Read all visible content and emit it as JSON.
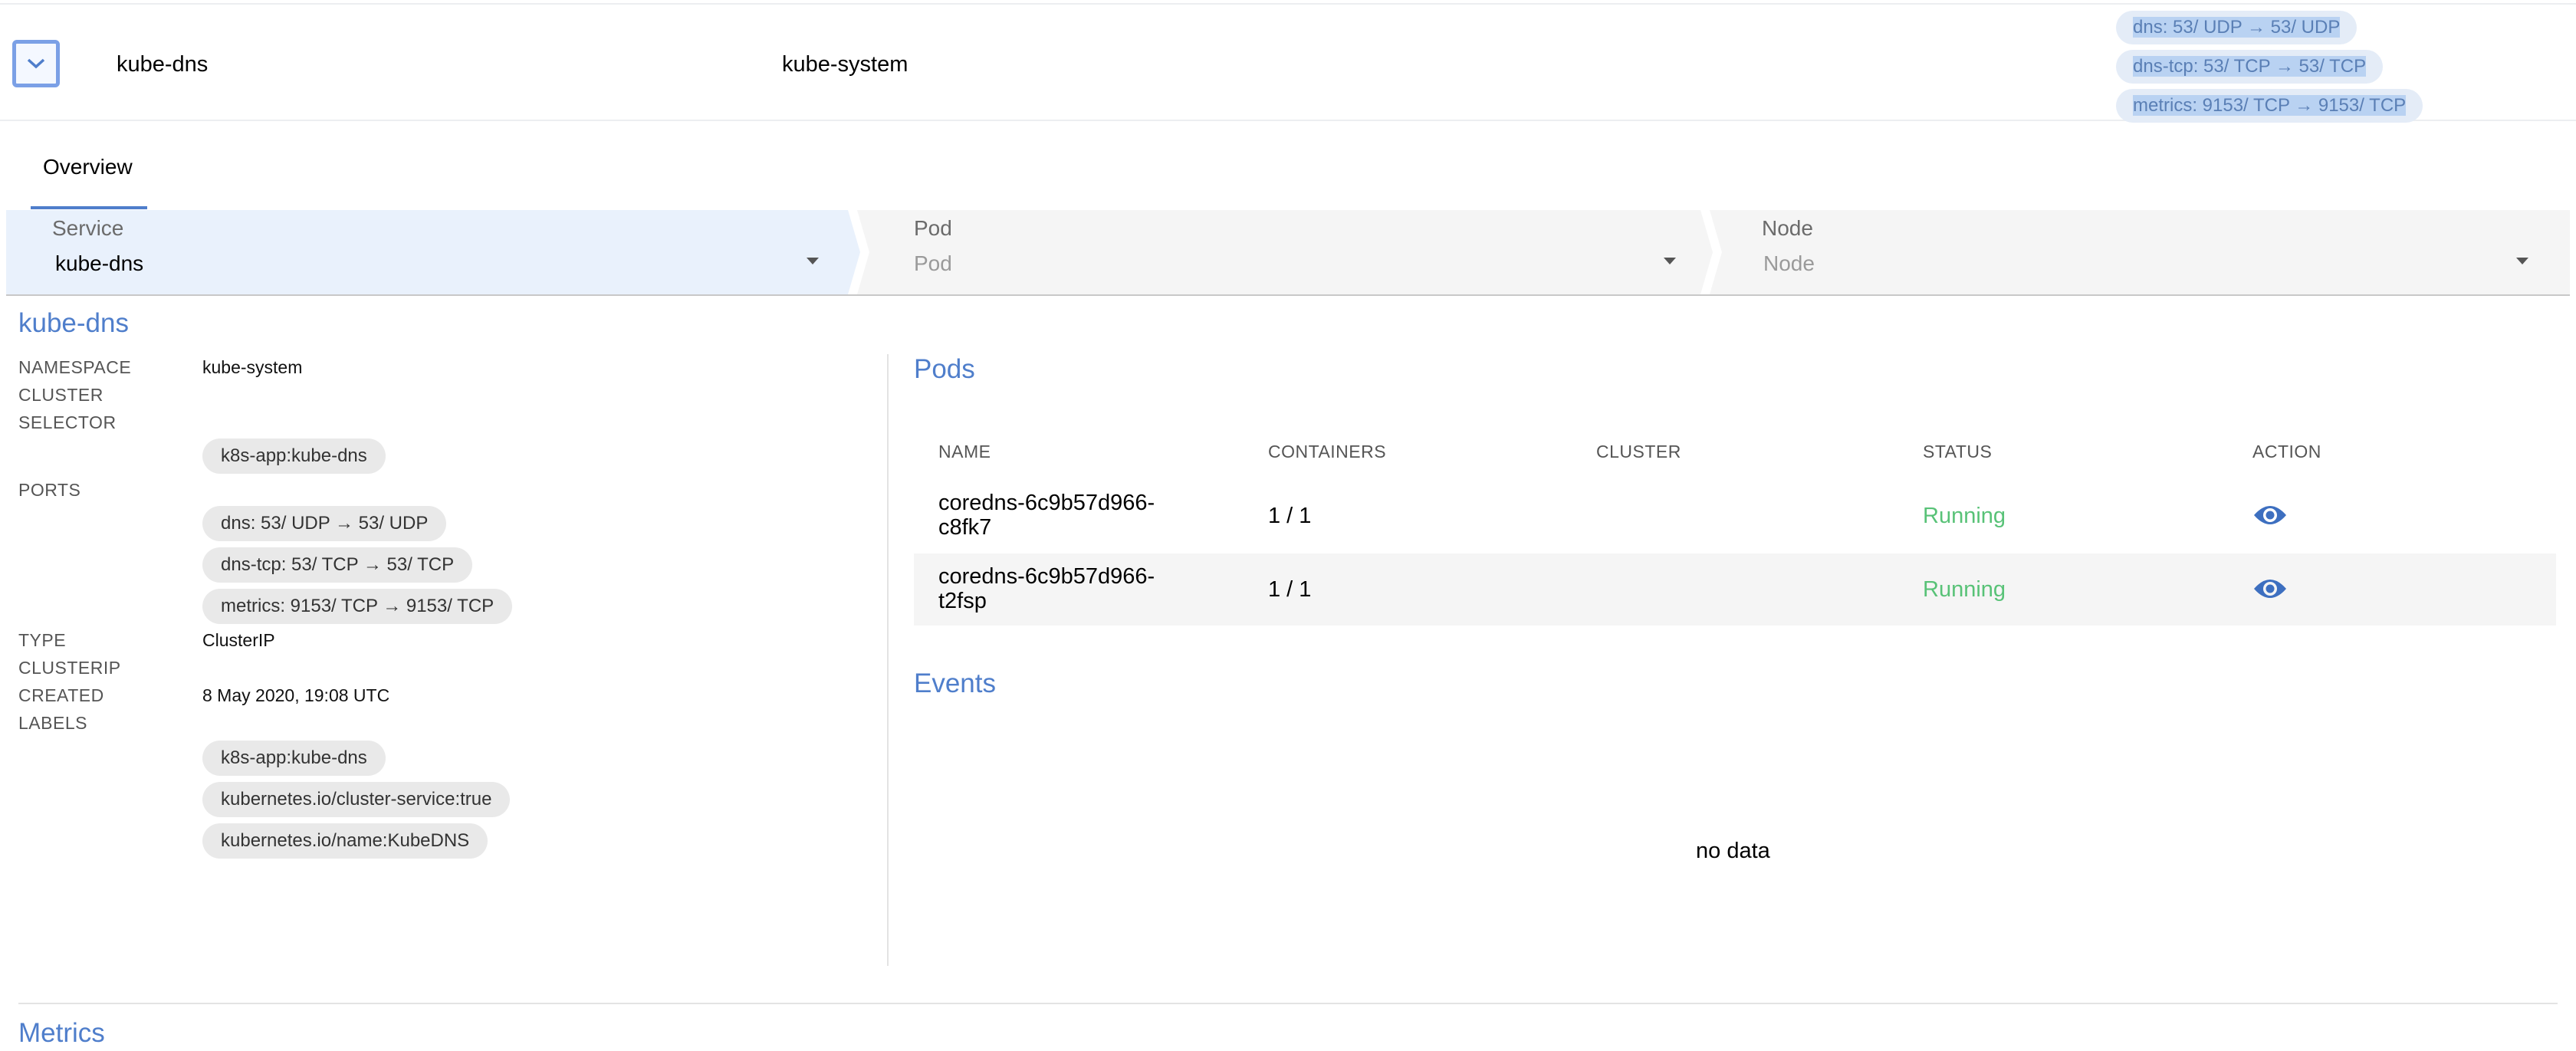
{
  "service_row": {
    "name": "kube-dns",
    "namespace": "kube-system",
    "ports": [
      "dns: 53/ UDP → 53/ UDP",
      "dns-tcp: 53/ TCP → 53/ TCP",
      "metrics: 9153/ TCP → 9153/ TCP"
    ]
  },
  "tabs": [
    {
      "label": "Overview"
    }
  ],
  "selectors": [
    {
      "label": "Service",
      "value": "kube-dns"
    },
    {
      "label": "Pod",
      "value": "Pod"
    },
    {
      "label": "Node",
      "value": "Node"
    }
  ],
  "details": {
    "title": "kube-dns",
    "namespace_label": "NAMESPACE",
    "namespace_value": "kube-system",
    "cluster_label": "CLUSTER",
    "selector_label": "SELECTOR",
    "selector_chips": [
      "k8s-app:kube-dns"
    ],
    "ports_label": "PORTS",
    "port_chips": [
      "dns: 53/ UDP → 53/ UDP",
      "dns-tcp: 53/ TCP → 53/ TCP",
      "metrics: 9153/ TCP → 9153/ TCP"
    ],
    "type_label": "TYPE",
    "type_value": "ClusterIP",
    "clusterip_label": "CLUSTERIP",
    "created_label": "CREATED",
    "created_value": "8 May 2020, 19:08 UTC",
    "labels_label": "LABELS",
    "label_chips": [
      "k8s-app:kube-dns",
      "kubernetes.io/cluster-service:true",
      "kubernetes.io/name:KubeDNS"
    ]
  },
  "pods": {
    "title": "Pods",
    "columns": [
      "NAME",
      "CONTAINERS",
      "CLUSTER",
      "STATUS",
      "ACTION"
    ],
    "rows": [
      {
        "name": "coredns-6c9b57d966-c8fk7",
        "containers": "1 / 1",
        "cluster": "",
        "status": "Running"
      },
      {
        "name": "coredns-6c9b57d966-t2fsp",
        "containers": "1 / 1",
        "cluster": "",
        "status": "Running"
      }
    ]
  },
  "events": {
    "title": "Events",
    "empty_text": "no data"
  },
  "metrics": {
    "title": "Metrics"
  },
  "colors": {
    "accent": "#4f7ecb",
    "running": "#58c277",
    "chip_bg": "#e9e9e9"
  },
  "icons": {
    "expand": "chevron-down-icon",
    "view": "eye-icon",
    "dropdown": "caret-down-icon"
  }
}
